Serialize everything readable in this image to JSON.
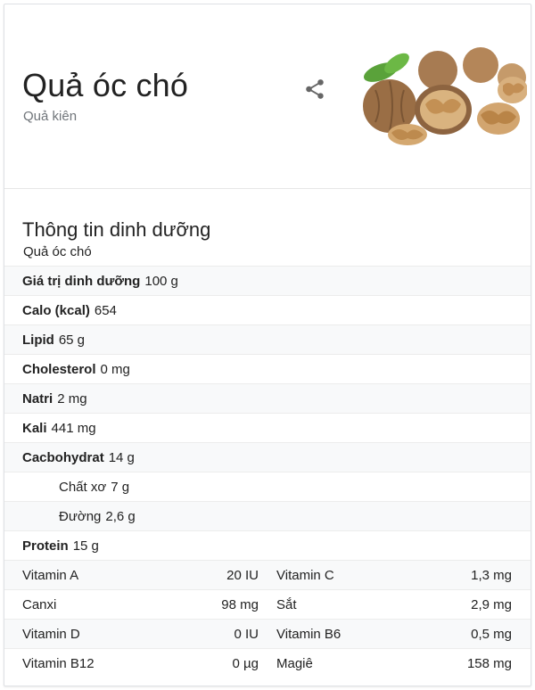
{
  "header": {
    "title": "Quả óc chó",
    "subtitle": "Quả kiên"
  },
  "nutrition": {
    "title": "Thông tin dinh dưỡng",
    "subtitle": "Quả óc chó",
    "rows": [
      {
        "label": "Giá trị dinh dưỡng",
        "value": "100 g"
      },
      {
        "label": "Calo (kcal)",
        "value": "654"
      },
      {
        "label": "Lipid",
        "value": "65 g"
      },
      {
        "label": "Cholesterol",
        "value": "0 mg"
      },
      {
        "label": "Natri",
        "value": "2 mg"
      },
      {
        "label": "Kali",
        "value": "441 mg"
      },
      {
        "label": "Cacbohydrat",
        "value": "14 g"
      },
      {
        "label": "Chất xơ",
        "value": "7 g"
      },
      {
        "label": "Đường",
        "value": "2,6 g"
      },
      {
        "label": "Protein",
        "value": "15 g"
      }
    ],
    "vitamins": [
      {
        "name1": "Vitamin A",
        "val1": "20 IU",
        "name2": "Vitamin C",
        "val2": "1,3 mg"
      },
      {
        "name1": "Canxi",
        "val1": "98 mg",
        "name2": "Sắt",
        "val2": "2,9 mg"
      },
      {
        "name1": "Vitamin D",
        "val1": "0 IU",
        "name2": "Vitamin B6",
        "val2": "0,5 mg"
      },
      {
        "name1": "Vitamin B12",
        "val1": "0 µg",
        "name2": "Magiê",
        "val2": "158 mg"
      }
    ]
  },
  "icons": {
    "share": "share-icon",
    "image": "walnut-image"
  },
  "colors": {
    "subtitle": "#70757a",
    "shade": "#f8f9fa",
    "divider": "#ececec"
  }
}
